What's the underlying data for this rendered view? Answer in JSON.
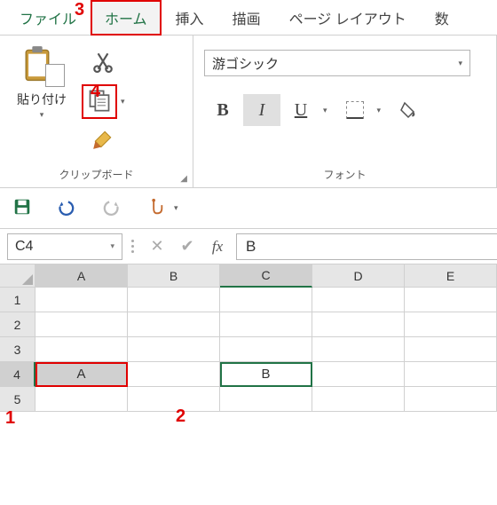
{
  "tabs": {
    "file": "ファイル",
    "home": "ホーム",
    "insert": "挿入",
    "draw": "描画",
    "layout": "ページ レイアウト",
    "formulas": "数"
  },
  "clipboard": {
    "paste_label": "貼り付け",
    "group_label": "クリップボード"
  },
  "font": {
    "name": "游ゴシック",
    "bold": "B",
    "italic": "I",
    "underline": "U",
    "group_label": "フォント"
  },
  "namebox": {
    "ref": "C4"
  },
  "formula": {
    "fx": "fx",
    "value": "B"
  },
  "columns": [
    "A",
    "B",
    "C",
    "D",
    "E"
  ],
  "rows": [
    "1",
    "2",
    "3",
    "4",
    "5"
  ],
  "cells": {
    "A4": "A",
    "C4": "B"
  },
  "annotations": {
    "n1": "1",
    "n2": "2",
    "n3": "3",
    "n4": "4"
  }
}
